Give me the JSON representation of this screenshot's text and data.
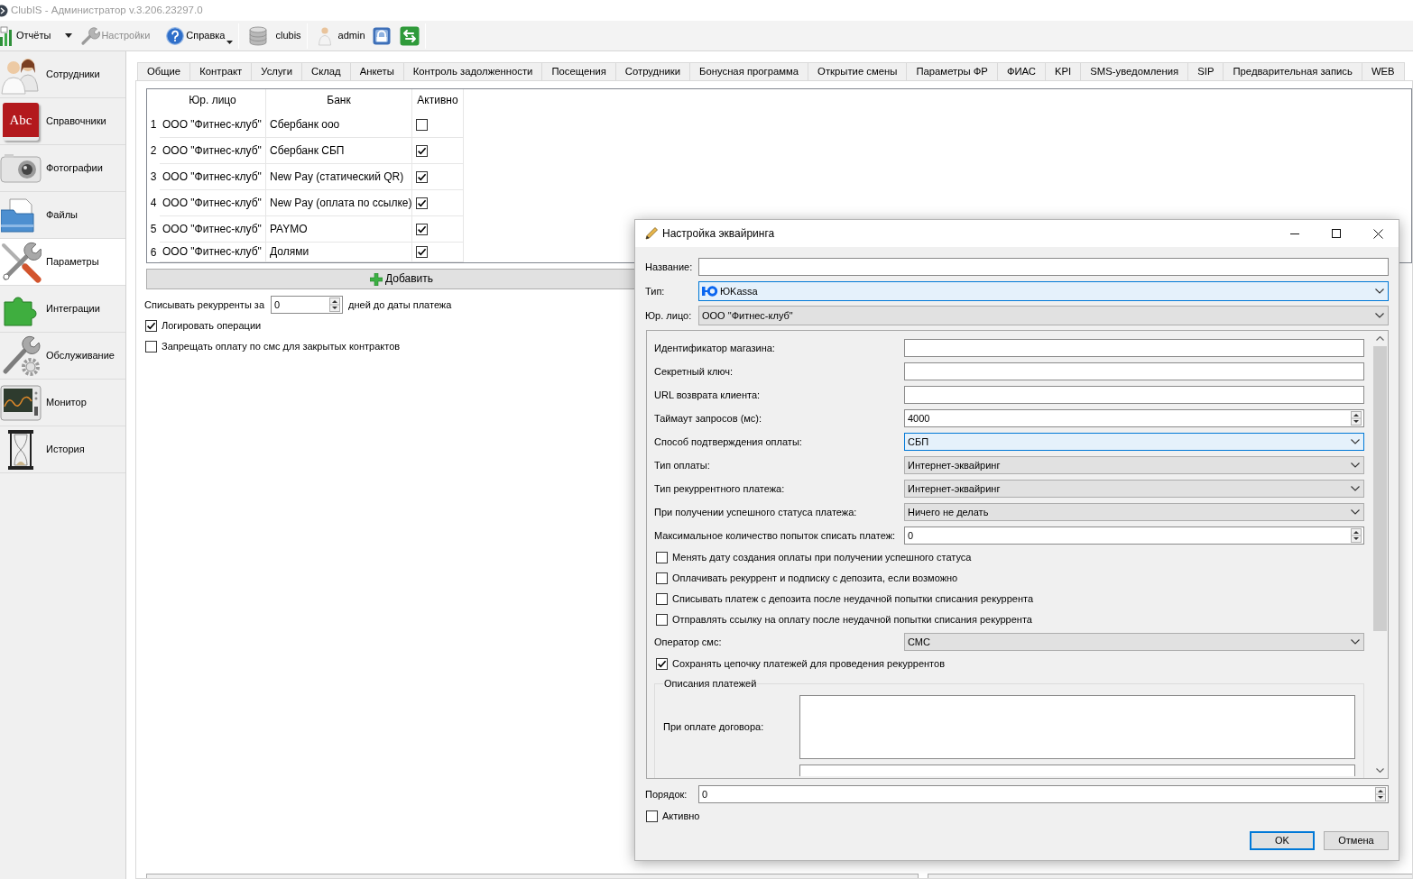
{
  "window": {
    "title": "ClubIS - Администратор v.3.206.23297.0"
  },
  "toolbar": [
    {
      "kind": "split",
      "label": "Отчёты",
      "disabled": false
    },
    {
      "kind": "button",
      "label": "Настройки",
      "disabled": true
    },
    {
      "kind": "menu",
      "label": "Справка",
      "disabled": false
    },
    {
      "kind": "label",
      "label": "clubis",
      "disabled": false
    },
    {
      "kind": "label",
      "label": "admin",
      "disabled": false
    }
  ],
  "sidebar": {
    "items": [
      {
        "label": "Сотрудники",
        "selected": false
      },
      {
        "label": "Справочники",
        "selected": false,
        "icon_text": "Abc"
      },
      {
        "label": "Фотографии",
        "selected": false
      },
      {
        "label": "Файлы",
        "selected": false
      },
      {
        "label": "Параметры",
        "selected": true
      },
      {
        "label": "Интеграции",
        "selected": false
      },
      {
        "label": "Обслуживание",
        "selected": false
      },
      {
        "label": "Монитор",
        "selected": false
      },
      {
        "label": "История",
        "selected": false
      }
    ]
  },
  "tabs": [
    {
      "label": "Общие",
      "selected": false
    },
    {
      "label": "Контракт",
      "selected": false
    },
    {
      "label": "Услуги",
      "selected": false
    },
    {
      "label": "Склад",
      "selected": false
    },
    {
      "label": "Анкеты",
      "selected": false
    },
    {
      "label": "Контроль задолженности",
      "selected": false
    },
    {
      "label": "Посещения",
      "selected": false
    },
    {
      "label": "Сотрудники",
      "selected": false
    },
    {
      "label": "Бонусная программа",
      "selected": false
    },
    {
      "label": "Открытие смены",
      "selected": false
    },
    {
      "label": "Параметры ФР",
      "selected": false
    },
    {
      "label": "ФИАС",
      "selected": false
    },
    {
      "label": "KPI",
      "selected": false
    },
    {
      "label": "SMS-уведомления",
      "selected": false
    },
    {
      "label": "SIP",
      "selected": false
    },
    {
      "label": "Предварительная запись",
      "selected": false
    },
    {
      "label": "WEB",
      "selected": false
    }
  ],
  "table": {
    "columns": [
      "Юр. лицо",
      "Банк",
      "Активно"
    ],
    "rows": [
      {
        "number": "1",
        "legal_entity": "ООО \"Фитнес-клуб\"",
        "bank": "Сбербанк ооо",
        "active": false
      },
      {
        "number": "2",
        "legal_entity": "ООО \"Фитнес-клуб\"",
        "bank": "Сбербанк СБП",
        "active": true
      },
      {
        "number": "3",
        "legal_entity": "ООО \"Фитнес-клуб\"",
        "bank": "New Pay (статический QR)",
        "active": true
      },
      {
        "number": "4",
        "legal_entity": "ООО \"Фитнес-клуб\"",
        "bank": "New Pay (оплата по ссылке)",
        "active": true
      },
      {
        "number": "5",
        "legal_entity": "ООО \"Фитнес-клуб\"",
        "bank": "PAYMO",
        "active": true
      },
      {
        "number": "6",
        "legal_entity": "ООО \"Фитнес-клуб\"",
        "bank": "Долями",
        "active": true
      }
    ]
  },
  "add_button": {
    "label": "Добавить"
  },
  "recurring": {
    "label": "Списывать рекурренты за",
    "value": "0",
    "suffix": "дней до даты платежа"
  },
  "options": [
    {
      "label": "Логировать операции",
      "checked": true
    },
    {
      "label": "Запрещать оплату по смс для закрытых контрактов",
      "checked": false
    }
  ],
  "dialog": {
    "title": "Настройка эквайринга",
    "name": {
      "label": "Название:"
    },
    "type": {
      "label": "Тип:",
      "value": "ЮKassa",
      "focused": true
    },
    "legal_entity": {
      "label": "Юр. лицо:",
      "value": "ООО \"Фитнес-клуб\"",
      "focused": false
    },
    "fields": [
      {
        "kind": "text",
        "label": "Идентификатор магазина:"
      },
      {
        "kind": "text",
        "label": "Секретный ключ:"
      },
      {
        "kind": "text",
        "label": "URL возврата клиента:"
      },
      {
        "kind": "spin",
        "label": "Таймаут запросов (мс):",
        "value": "4000"
      },
      {
        "kind": "combo",
        "label": "Способ подтверждения оплаты:",
        "value": "СБП",
        "focused": true
      },
      {
        "kind": "combo",
        "label": "Тип оплаты:",
        "value": "Интернет-эквайринг",
        "focused": false
      },
      {
        "kind": "combo",
        "label": "Тип рекуррентного платежа:",
        "value": "Интернет-эквайринг",
        "focused": false
      },
      {
        "kind": "combo",
        "label": "При получении успешного статуса платежа:",
        "value": "Ничего не делать",
        "focused": false
      },
      {
        "kind": "spin",
        "label": "Максимальное количество попыток списать платеж:",
        "value": "0"
      },
      {
        "kind": "checkbox",
        "label": "Менять дату создания оплаты при получении успешного статуса",
        "checked": false
      },
      {
        "kind": "checkbox",
        "label": "Оплачивать рекуррент и подписку с депозита, если возможно",
        "checked": false
      },
      {
        "kind": "checkbox",
        "label": "Списывать платеж с депозита после неудачной попытки списания рекуррента",
        "checked": false
      },
      {
        "kind": "checkbox",
        "label": "Отправлять ссылку на оплату после неудачной попытки списания рекуррента",
        "checked": false
      },
      {
        "kind": "combo",
        "label": "Оператор смс:",
        "value": "СМС",
        "focused": false
      },
      {
        "kind": "checkbox",
        "label": "Сохранять цепочку платежей для проведения рекуррентов",
        "checked": true
      }
    ],
    "descriptions": {
      "title": "Описания платежей",
      "items": [
        {
          "label": "При оплате договора:"
        }
      ]
    },
    "order": {
      "label": "Порядок:",
      "value": "0"
    },
    "active": {
      "label": "Активно",
      "checked": false
    },
    "buttons": [
      {
        "label": "OK",
        "default": true
      },
      {
        "label": "Отмена",
        "default": false
      }
    ]
  }
}
